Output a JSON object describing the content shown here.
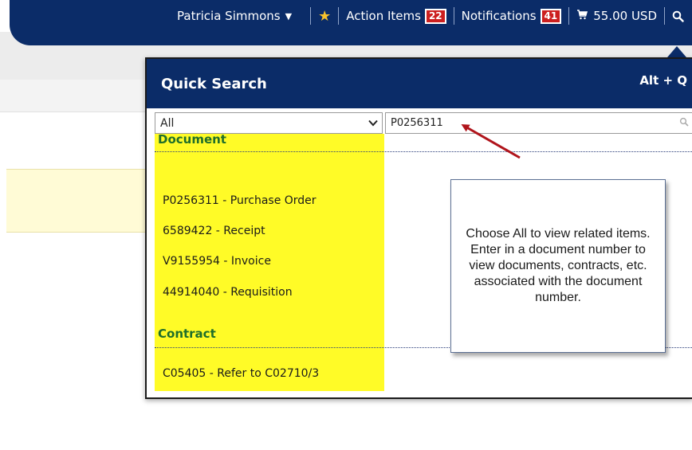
{
  "topnav": {
    "user_name": "Patricia Simmons",
    "action_items_label": "Action Items",
    "action_items_count": "22",
    "notifications_label": "Notifications",
    "notifications_count": "41",
    "cart_total": "55.00 USD"
  },
  "quick_search": {
    "title": "Quick Search",
    "shortcut": "Alt + Q",
    "filter_value": "All",
    "query_value": "P0256311",
    "sections": [
      {
        "heading": "Document",
        "items": [
          "P0256311 - Purchase Order",
          "6589422 - Receipt",
          "V9155954 - Invoice",
          "44914040 - Requisition"
        ]
      },
      {
        "heading": "Contract",
        "items": [
          "C05405 - Refer to C02710/3"
        ]
      }
    ]
  },
  "callout": {
    "text": "Choose All to view related items. Enter in a document number to view documents, contracts, etc. associated with the document number."
  },
  "colors": {
    "nav_blue": "#0b2c68",
    "badge_red": "#cc1f1f",
    "highlight_yellow": "#fffb27",
    "section_green": "#1f6e2a",
    "star_gold": "#f6c12c",
    "arrow_red": "#b0141b"
  },
  "icons": {
    "user_menu": "caret-down-icon",
    "favorites": "star-icon",
    "cart": "cart-icon",
    "search": "search-icon",
    "filter_dropdown": "chevron-down-icon"
  }
}
